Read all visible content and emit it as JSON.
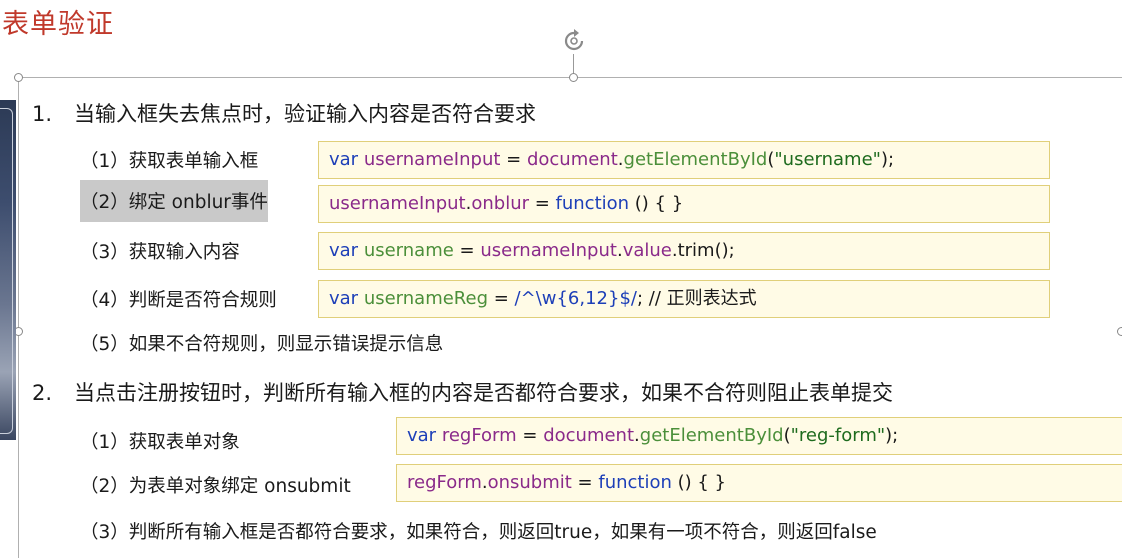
{
  "title": "表单验证",
  "section1": {
    "number": "1.",
    "text": "当输入框失去焦点时，验证输入内容是否符合要求",
    "steps": [
      {
        "label": "（1）获取表单输入框"
      },
      {
        "label": "（2）绑定 onblur事件"
      },
      {
        "label": "（3）获取输入内容"
      },
      {
        "label": "（4）判断是否符合规则"
      },
      {
        "label": "（5）如果不合符规则，则显示错误提示信息"
      }
    ],
    "code1": {
      "t1": "var",
      "t2": " usernameInput",
      "t3": " = ",
      "t4": "document",
      "t5": ".",
      "t6": "getElementById",
      "t7": "(",
      "t8": "\"username\"",
      "t9": ");"
    },
    "code2": {
      "t1": "usernameInput",
      "t2": ".",
      "t3": "onblur",
      "t4": " = ",
      "t5": "function",
      "t6": "  () { }"
    },
    "code3": {
      "t1": "var",
      "t2": " username",
      "t3": " = ",
      "t4": "usernameInput",
      "t5": ".",
      "t6": "value",
      "t7": ".trim();"
    },
    "code4": {
      "t1": "var",
      "t2": " usernameReg",
      "t3": " = ",
      "t4": "/^\\w{6,12}$/",
      "t5": "; // 正则表达式"
    }
  },
  "section2": {
    "number": "2.",
    "text": "当点击注册按钮时，判断所有输入框的内容是否都符合要求，如果不合符则阻止表单提交",
    "steps": [
      {
        "label": "（1）获取表单对象"
      },
      {
        "label": "（2）为表单对象绑定 onsubmit"
      },
      {
        "label": "（3）判断所有输入框是否都符合要求，如果符合，则返回true，如果有一项不符合，则返回false"
      }
    ],
    "code1": {
      "t1": "var",
      "t2": " regForm",
      "t3": " = ",
      "t4": "document",
      "t5": ".",
      "t6": "getElementById",
      "t7": "(",
      "t8": "\"reg-form\"",
      "t9": ");"
    },
    "code2": {
      "t1": "regForm",
      "t2": ".",
      "t3": "onsubmit",
      "t4": " = ",
      "t5": "function",
      "t6": " () { }"
    }
  },
  "icons": {
    "rotate": "rotate-icon"
  }
}
